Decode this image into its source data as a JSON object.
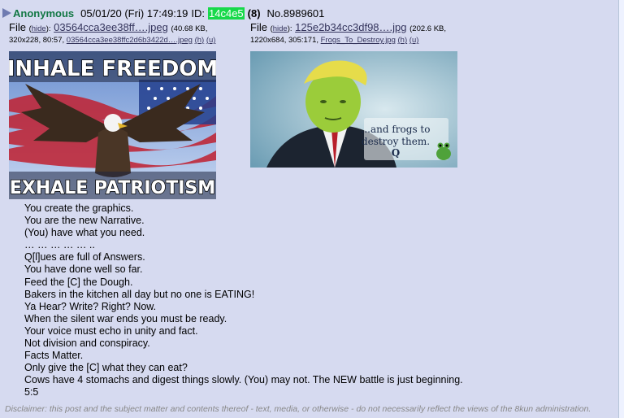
{
  "post": {
    "name": "Anonymous",
    "date": "05/01/20 (Fri) 17:49:19",
    "id_label": "ID:",
    "id_value": "14c4e5",
    "post_count": "(8)",
    "number": "No.8989601"
  },
  "files": [
    {
      "label": "File",
      "hide_link": "hide",
      "filename": "03564cca3ee38ff….jpeg",
      "size": "(40.68 KB,",
      "meta": "320x228, 80:57,",
      "original_name": "03564cca3ee38ffc2d6b3422d….jpeg",
      "h_link": "(h)",
      "u_link": "(u)",
      "top_text": "INHALE FREEDOM",
      "bottom_text": "EXHALE PATRIOTISM"
    },
    {
      "label": "File",
      "hide_link": "hide",
      "filename": "125e2b34cc3df98….jpg",
      "size": "(202.6 KB,",
      "meta": "1220x684, 305:171,",
      "original_name": "Frogs_To_Destroy.jpg",
      "h_link": "(h)",
      "u_link": "(u)",
      "caption_line1": "...and frogs to",
      "caption_line2": "destroy them.",
      "caption_line3": "Q"
    }
  ],
  "body_lines": [
    "You create the graphics.",
    "You are the new Narrative.",
    "(You) have what you need.",
    "… … … … … ..",
    "Q[l]ues are full of Answers.",
    "You have done well so far.",
    "Feed the [C] the Dough.",
    "Bakers in the kitchen all day but no one is EATING!",
    "Ya Hear? Write? Right? Now.",
    "When the silent war ends you must be ready.",
    "Your voice must echo in unity and fact.",
    "Not division and conspiracy.",
    "Facts Matter.",
    "Only give the [C] what they can eat?",
    "Cows have 4 stomachs and digest things slowly. (You) may not. The NEW battle is just beginning.",
    "5:5"
  ],
  "disclaimer": "Disclaimer: this post and the subject matter and contents thereof - text, media, or otherwise - do not necessarily reflect the views of the 8kun administration.",
  "colors": {
    "name": "#117743",
    "id_bg": "#17d94a",
    "post_bg": "#d6daf0",
    "link": "#34345c"
  }
}
